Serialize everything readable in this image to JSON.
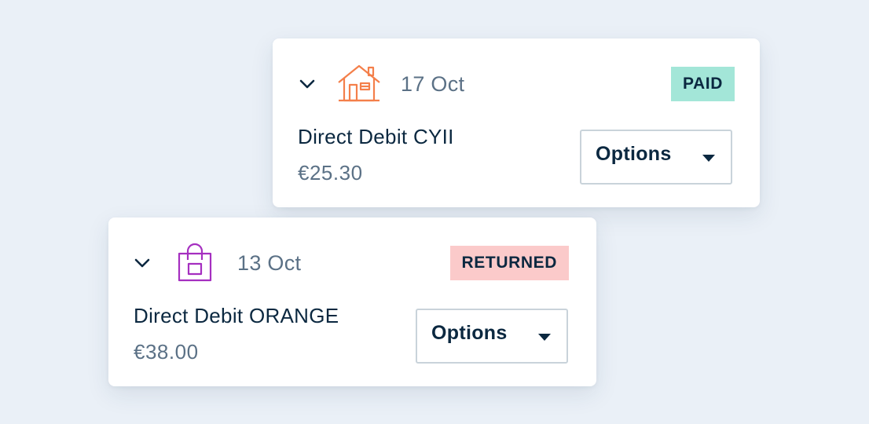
{
  "payments": [
    {
      "date": "17 Oct",
      "status": "PAID",
      "status_color": "#a3e6d8",
      "description": "Direct Debit CYII",
      "amount": "€25.30",
      "category_icon": "house-icon",
      "icon_color": "#f47f4a",
      "options_label": "Options"
    },
    {
      "date": "13 Oct",
      "status": "RETURNED",
      "status_color": "#fbcaca",
      "description": "Direct Debit ORANGE",
      "amount": "€38.00",
      "category_icon": "shopping-bag-icon",
      "icon_color": "#a52fc0",
      "options_label": "Options"
    }
  ],
  "colors": {
    "background": "#eaf0f7",
    "text_primary": "#0b2840",
    "text_secondary": "#5b7186",
    "border": "#c9d3da"
  }
}
